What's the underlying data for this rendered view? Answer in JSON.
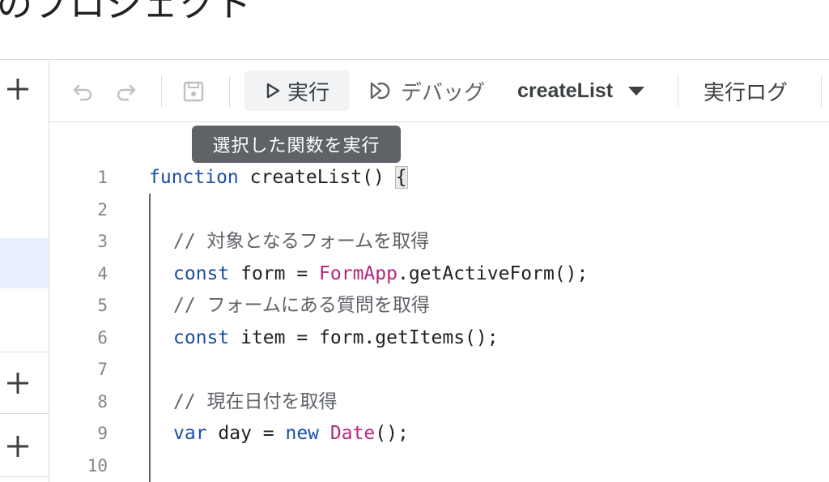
{
  "header": {
    "project_title": "のプロジェクト"
  },
  "toolbar": {
    "run_label": "実行",
    "debug_label": "デバッグ",
    "function_selected": "createList",
    "log_label": "実行ログ"
  },
  "tooltip": {
    "text": "選択した関数を実行"
  },
  "editor": {
    "line_numbers": [
      "1",
      "2",
      "3",
      "4",
      "5",
      "6",
      "7",
      "8",
      "9",
      "10"
    ],
    "lines": {
      "l1_kw": "function",
      "l1_rest": " createList() ",
      "l1_brace": "{",
      "l3_comment": "// 対象となるフォームを取得",
      "l4_kw": "const",
      "l4_mid": " form = ",
      "l4_cls": "FormApp",
      "l4_rest": ".getActiveForm();",
      "l5_comment": "// フォームにある質問を取得",
      "l6_kw": "const",
      "l6_rest": " item = form.getItems();",
      "l8_comment": "// 現在日付を取得",
      "l9_kw": "var",
      "l9_mid": " day = ",
      "l9_kw2": "new",
      "l9_sp": " ",
      "l9_cls": "Date",
      "l9_rest": "();"
    }
  },
  "icons": {
    "add": "plus-icon",
    "undo": "undo-icon",
    "redo": "redo-icon",
    "save": "save-icon",
    "run": "play-icon",
    "debug": "debug-icon",
    "dropdown": "caret-down-icon"
  },
  "colors": {
    "keyword": "#1a4fa3",
    "class": "#b5267c",
    "comment": "#5f6368",
    "tooltip_bg": "#5f6368",
    "selected_rail": "#e8f0fe"
  }
}
